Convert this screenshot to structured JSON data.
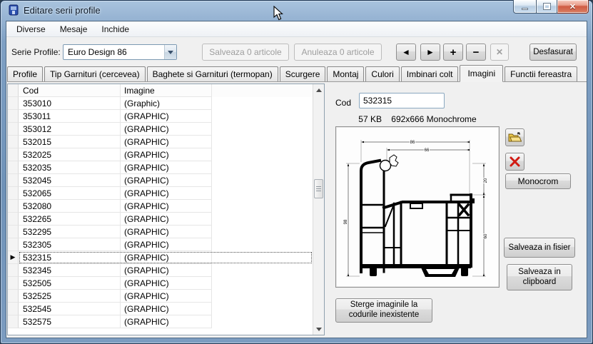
{
  "window": {
    "title": "Editare serii profile"
  },
  "menu": {
    "items": [
      "Diverse",
      "Mesaje",
      "Inchide"
    ]
  },
  "toolbar": {
    "serie_label": "Serie Profile:",
    "serie_value": "Euro Design 86",
    "save_button": "Salveaza 0 articole",
    "cancel_button": "Anuleaza 0 articole",
    "expand_button": "Desfasurat"
  },
  "icons": {
    "nav_prev": "◄",
    "nav_next": "►",
    "nav_add": "+",
    "nav_remove": "−",
    "nav_delete": "✕",
    "close": "✕",
    "row_pointer": "▶"
  },
  "tabs": {
    "items": [
      "Profile",
      "Tip Garnituri (cercevea)",
      "Baghete si Garnituri (termopan)",
      "Scurgere",
      "Montaj",
      "Culori",
      "Imbinari colt",
      "Imagini",
      "Functii fereastra"
    ],
    "active_index": 7
  },
  "table": {
    "columns": {
      "cod": "Cod",
      "imagine": "Imagine"
    },
    "selected_cod": "532315",
    "rows": [
      [
        "353010",
        "(Graphic)"
      ],
      [
        "353011",
        "(GRAPHIC)"
      ],
      [
        "353012",
        "(GRAPHIC)"
      ],
      [
        "532015",
        "(GRAPHIC)"
      ],
      [
        "532025",
        "(GRAPHIC)"
      ],
      [
        "532035",
        "(GRAPHIC)"
      ],
      [
        "532045",
        "(GRAPHIC)"
      ],
      [
        "532065",
        "(GRAPHIC)"
      ],
      [
        "532080",
        "(GRAPHIC)"
      ],
      [
        "532265",
        "(GRAPHIC)"
      ],
      [
        "532295",
        "(GRAPHIC)"
      ],
      [
        "532305",
        "(GRAPHIC)"
      ],
      [
        "532315",
        "(GRAPHIC)"
      ],
      [
        "532345",
        "(GRAPHIC)"
      ],
      [
        "532505",
        "(GRAPHIC)"
      ],
      [
        "532525",
        "(GRAPHIC)"
      ],
      [
        "532545",
        "(GRAPHIC)"
      ],
      [
        "532575",
        "(GRAPHIC)"
      ]
    ]
  },
  "detail": {
    "cod_label": "Cod",
    "cod_value": "532315",
    "image_info": "57 KB    692x666 Monochrome",
    "monochrome_button": "Monocrom",
    "save_file_button": "Salveaza in fisier",
    "save_clipboard_button": "Salveaza in clipboard",
    "delete_missing_button": "Sterge imaginile la codurile inexistente",
    "drawing": {
      "top_width": "86",
      "inner_width": "66",
      "left_height": "98",
      "right_upper": "20",
      "right_lower": "60"
    }
  }
}
